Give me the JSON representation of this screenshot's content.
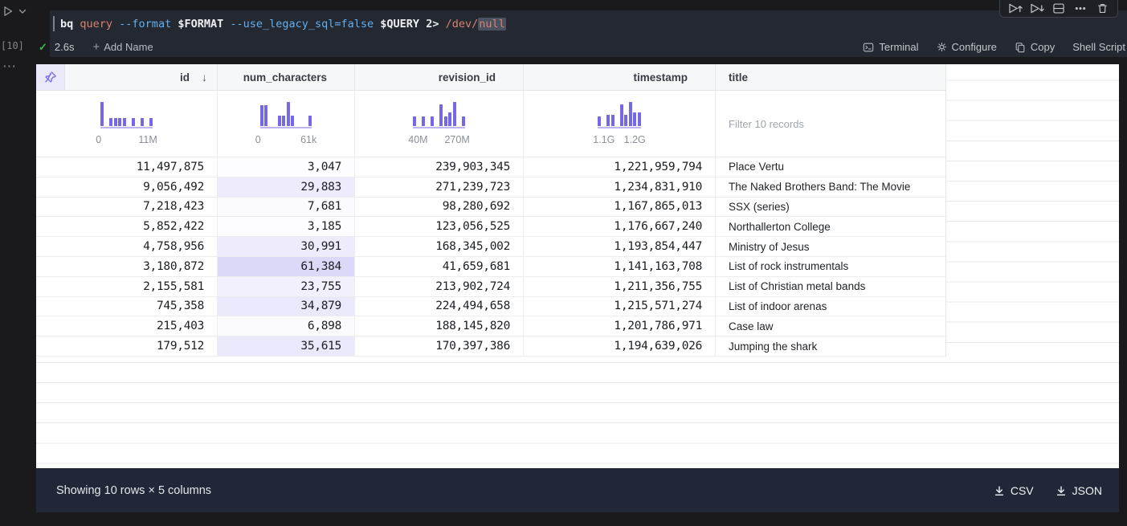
{
  "colors": {
    "accent_purple": "#7468e4",
    "histogram_bar": "#7468e4",
    "histogram_axis": "#bcb5f1",
    "pin_cell_bg": "#e9e9fa",
    "num_characters_shade_rgb": "116,104,228",
    "code_selection_bg": "#4a5160",
    "success_green": "#3fb950",
    "footer_bg": "#212736",
    "code_flag_blue": "#61afef",
    "code_arg_orange": "#d9826e"
  },
  "gutter": {
    "execution_count": "[10]"
  },
  "cell": {
    "command_tokens": [
      {
        "text": "bq ",
        "style": "cmd"
      },
      {
        "text": "query ",
        "style": "arg"
      },
      {
        "text": "--format ",
        "style": "flag"
      },
      {
        "text": "$FORMAT ",
        "style": "var"
      },
      {
        "text": "--use_legacy_sql=false ",
        "style": "flag"
      },
      {
        "text": "$QUERY ",
        "style": "var"
      },
      {
        "text": "2> ",
        "style": "plain"
      },
      {
        "text": "/dev/",
        "style": "arg"
      },
      {
        "text": "null",
        "style": "arg-selected"
      }
    ],
    "status": {
      "duration": "2.6s",
      "add_name": "Add Name"
    },
    "actions": [
      {
        "label": "Terminal",
        "icon": "terminal"
      },
      {
        "label": "Configure",
        "icon": "gear"
      },
      {
        "label": "Copy",
        "icon": "copy"
      },
      {
        "label": "Shell Script",
        "icon": ""
      }
    ],
    "toolbar": [
      {
        "name": "run-all-above",
        "icon": "play-up"
      },
      {
        "name": "run-all-below",
        "icon": "play-down"
      },
      {
        "name": "split-cell",
        "icon": "split"
      },
      {
        "name": "more-options",
        "icon": "ellipsis"
      },
      {
        "name": "delete-cell",
        "icon": "trash"
      }
    ]
  },
  "table": {
    "columns": [
      {
        "key": "id",
        "label": "id",
        "type": "number",
        "sorted": "desc",
        "histogram": {
          "min_label": "0",
          "max_label": "11M",
          "bars": [
            1,
            0,
            0.32,
            0.32,
            0.32,
            0.32,
            0,
            0.32,
            0,
            0.32,
            0,
            0.32
          ]
        }
      },
      {
        "key": "num_characters",
        "label": "num_characters",
        "type": "number",
        "shaded": true,
        "histogram": {
          "min_label": "0",
          "max_label": "61k",
          "bars": [
            0.85,
            0.85,
            0,
            0,
            0.42,
            0.42,
            1,
            0.42,
            0,
            0,
            0,
            0.42
          ]
        }
      },
      {
        "key": "revision_id",
        "label": "revision_id",
        "type": "number",
        "histogram": {
          "min_label": "40M",
          "max_label": "270M",
          "bars": [
            0.4,
            0,
            0.4,
            0,
            0.4,
            0,
            0.9,
            0.4,
            0.55,
            1,
            0,
            0.4
          ]
        }
      },
      {
        "key": "timestamp",
        "label": "timestamp",
        "type": "number",
        "histogram": {
          "min_label": "1.1G",
          "max_label": "1.2G",
          "bars": [
            0.4,
            0,
            0.45,
            0.45,
            0,
            0.9,
            0.45,
            1,
            0.55,
            0.55
          ]
        }
      },
      {
        "key": "title",
        "label": "title",
        "type": "text",
        "filter_placeholder": "Filter 10 records"
      }
    ],
    "rows": [
      {
        "id": "11,497,875",
        "num_characters": "3,047",
        "revision_id": "239,903,345",
        "timestamp": "1,221,959,794",
        "title": "Place Vertu"
      },
      {
        "id": "9,056,492",
        "num_characters": "29,883",
        "revision_id": "271,239,723",
        "timestamp": "1,234,831,910",
        "title": "The Naked Brothers Band: The Movie"
      },
      {
        "id": "7,218,423",
        "num_characters": "7,681",
        "revision_id": "98,280,692",
        "timestamp": "1,167,865,013",
        "title": "SSX (series)"
      },
      {
        "id": "5,852,422",
        "num_characters": "3,185",
        "revision_id": "123,056,525",
        "timestamp": "1,176,667,240",
        "title": "Northallerton College"
      },
      {
        "id": "4,758,956",
        "num_characters": "30,991",
        "revision_id": "168,345,002",
        "timestamp": "1,193,854,447",
        "title": "Ministry of Jesus"
      },
      {
        "id": "3,180,872",
        "num_characters": "61,384",
        "revision_id": "41,659,681",
        "timestamp": "1,141,163,708",
        "title": "List of rock instrumentals"
      },
      {
        "id": "2,155,581",
        "num_characters": "23,755",
        "revision_id": "213,902,724",
        "timestamp": "1,211,356,755",
        "title": "List of Christian metal bands"
      },
      {
        "id": "745,358",
        "num_characters": "34,879",
        "revision_id": "224,494,658",
        "timestamp": "1,215,571,274",
        "title": "List of indoor arenas"
      },
      {
        "id": "215,403",
        "num_characters": "6,898",
        "revision_id": "188,145,820",
        "timestamp": "1,201,786,971",
        "title": "Case law"
      },
      {
        "id": "179,512",
        "num_characters": "35,615",
        "revision_id": "170,397,386",
        "timestamp": "1,194,639,026",
        "title": "Jumping the shark"
      }
    ],
    "footer": {
      "summary": "Showing 10 rows × 5 columns",
      "downloads": [
        {
          "label": "CSV"
        },
        {
          "label": "JSON"
        }
      ]
    }
  }
}
